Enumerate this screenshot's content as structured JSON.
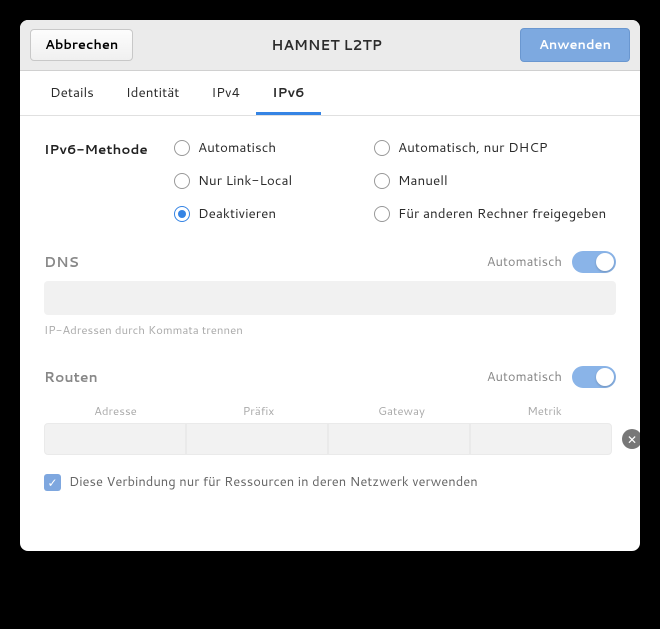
{
  "titlebar": {
    "cancel": "Abbrechen",
    "title": "HAMNET L2TP",
    "apply": "Anwenden"
  },
  "tabs": {
    "details": "Details",
    "identity": "Identität",
    "ipv4": "IPv4",
    "ipv6": "IPv6",
    "active": "ipv6"
  },
  "method": {
    "label": "IPv6-Methode",
    "options": {
      "auto": "Automatisch",
      "auto_dhcp": "Automatisch, nur DHCP",
      "linklocal": "Nur Link-Local",
      "manual": "Manuell",
      "disable": "Deaktivieren",
      "shared": "Für anderen Rechner freigegeben"
    },
    "selected": "disable"
  },
  "dns": {
    "label": "DNS",
    "auto_label": "Automatisch",
    "hint": "IP-Adressen durch Kommata trennen",
    "value": ""
  },
  "routes": {
    "label": "Routen",
    "auto_label": "Automatisch",
    "cols": {
      "address": "Adresse",
      "prefix": "Präfix",
      "gateway": "Gateway",
      "metric": "Metrik"
    },
    "row": {
      "address": "",
      "prefix": "",
      "gateway": "",
      "metric": ""
    }
  },
  "only_resources": {
    "label": "Diese Verbindung nur für Ressourcen in deren Netzwerk verwenden",
    "checked": true
  }
}
